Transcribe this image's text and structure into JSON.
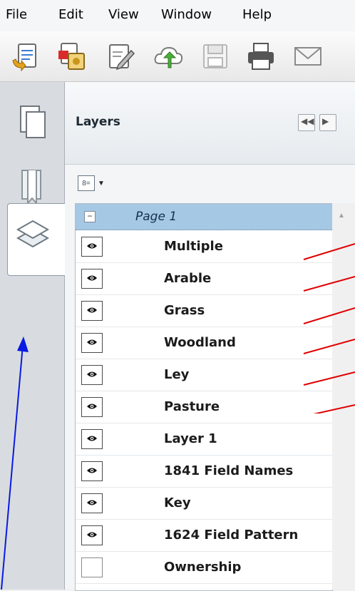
{
  "menubar": {
    "items": [
      "File",
      "Edit",
      "View",
      "Window",
      "Help"
    ]
  },
  "toolbar": {
    "buttons": [
      "create-pdf-icon",
      "convert-icon",
      "edit-icon",
      "upload-cloud-icon",
      "save-icon",
      "print-icon",
      "email-icon"
    ]
  },
  "nav": {
    "buttons": [
      "pages-icon",
      "bookmarks-icon",
      "attachments-icon",
      "layers-icon"
    ],
    "active": "layers-icon"
  },
  "panel": {
    "title": "Layers",
    "header_buttons": [
      "collapse-panel-icon",
      "expand-panel-icon"
    ],
    "options_icon": "options-menu-icon"
  },
  "tree": {
    "page_label": "Page 1",
    "collapse_symbol": "−",
    "layers": [
      {
        "label": "Multiple",
        "visible": true
      },
      {
        "label": "Arable",
        "visible": true
      },
      {
        "label": "Grass",
        "visible": true
      },
      {
        "label": "Woodland",
        "visible": true
      },
      {
        "label": "Ley",
        "visible": true
      },
      {
        "label": "Pasture",
        "visible": true
      },
      {
        "label": "Layer 1",
        "visible": true
      },
      {
        "label": "1841 Field Names",
        "visible": true
      },
      {
        "label": "Key",
        "visible": true
      },
      {
        "label": "1624 Field Pattern",
        "visible": true
      },
      {
        "label": "Ownership",
        "visible": false
      }
    ]
  },
  "colors": {
    "page_row": "#a5c8e4",
    "annotation_red": "#e00000",
    "annotation_blue": "#0a1ae0"
  }
}
